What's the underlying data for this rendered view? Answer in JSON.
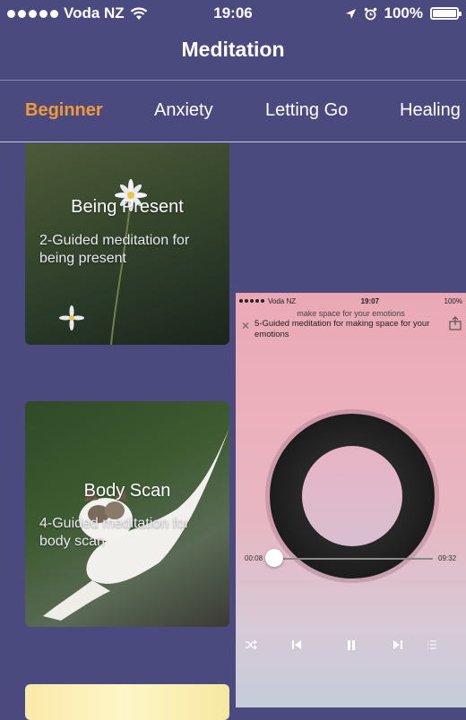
{
  "status_bar": {
    "carrier": "Voda NZ",
    "time": "19:06",
    "battery": "100%"
  },
  "header": {
    "title": "Meditation"
  },
  "tabs": [
    {
      "label": "Beginner",
      "active": true
    },
    {
      "label": "Anxiety",
      "active": false
    },
    {
      "label": "Letting Go",
      "active": false
    },
    {
      "label": "Healing",
      "active": false
    }
  ],
  "cards": [
    {
      "title": "Being Present",
      "description": "2-Guided meditation for being present"
    },
    {
      "title": "Body Scan",
      "description": "4-Guided meditation for body scan"
    }
  ],
  "player": {
    "status_bar": {
      "carrier": "Voda NZ",
      "time": "19:07",
      "battery": "100%"
    },
    "subtitle": "make space for your emotions",
    "title": "5-Guided meditation for making space for your emotions",
    "current_time": "00:08",
    "total_time": "09:32",
    "progress": 0.014
  },
  "colors": {
    "accent": "#f29a3a",
    "background": "#4a4a7e"
  },
  "icons": [
    "wifi-icon",
    "location-arrow-icon",
    "alarm-clock-icon",
    "battery-icon",
    "close-icon",
    "share-icon",
    "shuffle-icon",
    "previous-icon",
    "pause-icon",
    "next-icon",
    "playlist-icon"
  ]
}
